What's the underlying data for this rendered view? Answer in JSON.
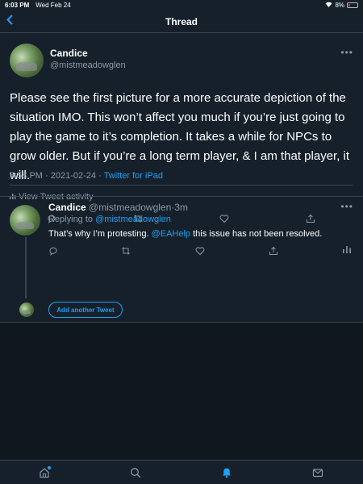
{
  "status": {
    "time": "6:03 PM",
    "date": "Wed Feb 24",
    "battery": "8%"
  },
  "nav": {
    "title": "Thread"
  },
  "main_tweet": {
    "name": "Candice",
    "handle": "@mistmeadowglen",
    "text": "Please see the first picture for a more accurate depiction of the situation IMO. This won’t affect you much if you’re just going to play the game to it’s completion. It takes a while for NPCs to grow older. But if you’re a long term player, & I am that player, it will.",
    "time": "5:58 PM",
    "date": "2021-02-24",
    "client": "Twitter for iPad",
    "activity_label": "View Tweet activity"
  },
  "reply": {
    "name": "Candice",
    "handle": "@mistmeadowglen",
    "age": "3m",
    "replying_prefix": "Replying to",
    "replying_to": "@mistmeadowglen",
    "text_before": "That’s why I’m protesting.",
    "mention": "@EAHelp",
    "text_after": "this issue has not been resolved."
  },
  "compose": {
    "add_label": "Add another Tweet"
  },
  "colors": {
    "background": "#15202b",
    "accent": "#1da1f2",
    "secondary_text": "#8899a6",
    "divider": "#38444d"
  }
}
